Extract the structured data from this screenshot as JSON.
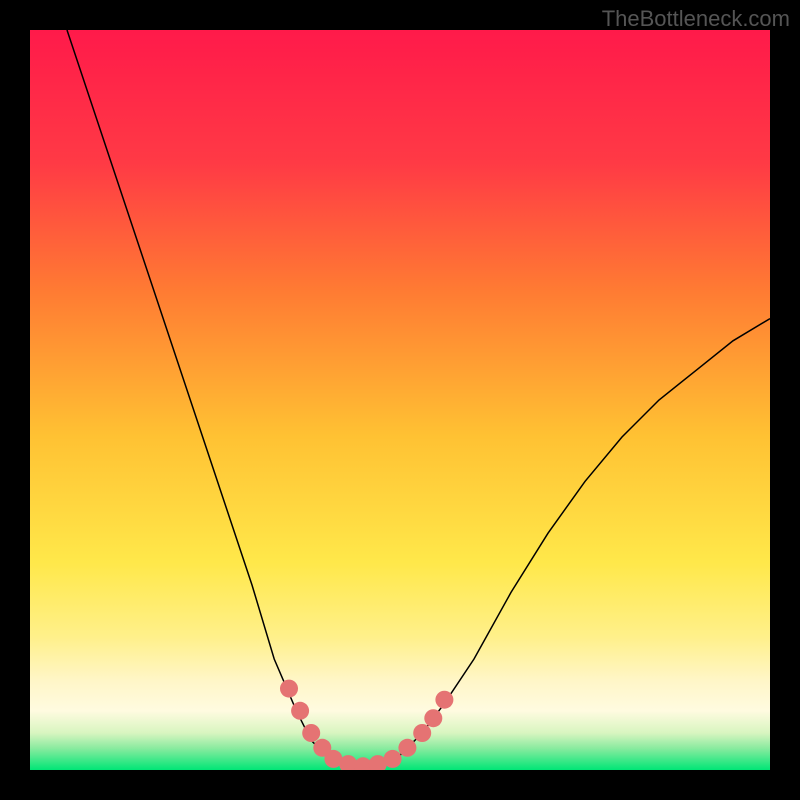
{
  "watermark": "TheBottleneck.com",
  "chart_data": {
    "type": "line",
    "title": "",
    "xlabel": "",
    "ylabel": "",
    "x_range": [
      0,
      100
    ],
    "y_range": [
      0,
      100
    ],
    "gradient_colors": {
      "top": "#ff1a4a",
      "mid_upper": "#ff7a33",
      "mid": "#ffe84a",
      "mid_lower": "#fff39a",
      "bottom": "#00e676"
    },
    "series": [
      {
        "name": "curve",
        "color": "#000000",
        "stroke_width": 1.5,
        "points": [
          {
            "x": 5,
            "y": 100
          },
          {
            "x": 10,
            "y": 85
          },
          {
            "x": 15,
            "y": 70
          },
          {
            "x": 20,
            "y": 55
          },
          {
            "x": 25,
            "y": 40
          },
          {
            "x": 30,
            "y": 25
          },
          {
            "x": 33,
            "y": 15
          },
          {
            "x": 36,
            "y": 8
          },
          {
            "x": 38,
            "y": 4
          },
          {
            "x": 40,
            "y": 2
          },
          {
            "x": 42,
            "y": 1
          },
          {
            "x": 44,
            "y": 0.5
          },
          {
            "x": 46,
            "y": 0.5
          },
          {
            "x": 48,
            "y": 1
          },
          {
            "x": 50,
            "y": 2
          },
          {
            "x": 53,
            "y": 5
          },
          {
            "x": 56,
            "y": 9
          },
          {
            "x": 60,
            "y": 15
          },
          {
            "x": 65,
            "y": 24
          },
          {
            "x": 70,
            "y": 32
          },
          {
            "x": 75,
            "y": 39
          },
          {
            "x": 80,
            "y": 45
          },
          {
            "x": 85,
            "y": 50
          },
          {
            "x": 90,
            "y": 54
          },
          {
            "x": 95,
            "y": 58
          },
          {
            "x": 100,
            "y": 61
          }
        ]
      },
      {
        "name": "highlighted-dots",
        "color": "#e57373",
        "radius": 9,
        "points": [
          {
            "x": 35,
            "y": 11
          },
          {
            "x": 36.5,
            "y": 8
          },
          {
            "x": 38,
            "y": 5
          },
          {
            "x": 39.5,
            "y": 3
          },
          {
            "x": 41,
            "y": 1.5
          },
          {
            "x": 43,
            "y": 0.8
          },
          {
            "x": 45,
            "y": 0.5
          },
          {
            "x": 47,
            "y": 0.8
          },
          {
            "x": 49,
            "y": 1.5
          },
          {
            "x": 51,
            "y": 3
          },
          {
            "x": 53,
            "y": 5
          },
          {
            "x": 54.5,
            "y": 7
          },
          {
            "x": 56,
            "y": 9.5
          }
        ]
      }
    ]
  }
}
